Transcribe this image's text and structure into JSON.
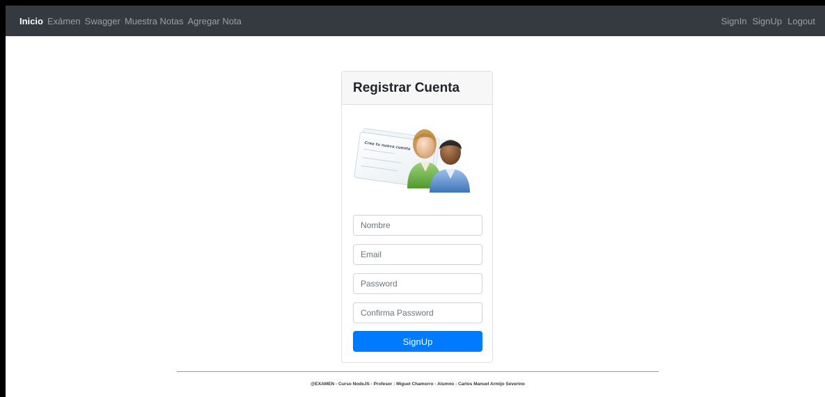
{
  "navbar": {
    "left_links": [
      {
        "label": "Inicio",
        "active": true
      },
      {
        "label": "Exámen",
        "active": false
      },
      {
        "label": "Swagger",
        "active": false
      },
      {
        "label": "Muestra Notas",
        "active": false
      },
      {
        "label": "Agregar Nota",
        "active": false
      }
    ],
    "right_links": [
      {
        "label": "SignIn"
      },
      {
        "label": "SignUp"
      },
      {
        "label": "Logout"
      }
    ]
  },
  "card": {
    "title": "Registrar Cuenta",
    "illustration": {
      "icon": "new-account-users-icon",
      "caption": "Crea tu nueva cuenta"
    },
    "fields": {
      "nombre_placeholder": "Nombre",
      "email_placeholder": "Email",
      "password_placeholder": "Password",
      "confirm_placeholder": "Confirma Password"
    },
    "submit_label": "SignUp"
  },
  "footer": {
    "text": "@EXAMEN - Curso NodeJS - Profesor : Miguel Chamorro - Alumno : Carlos Manuel Armijo Severino"
  },
  "colors": {
    "navbar_bg": "#343a40",
    "primary": "#007bff",
    "card_header_bg": "#f7f7f7"
  }
}
